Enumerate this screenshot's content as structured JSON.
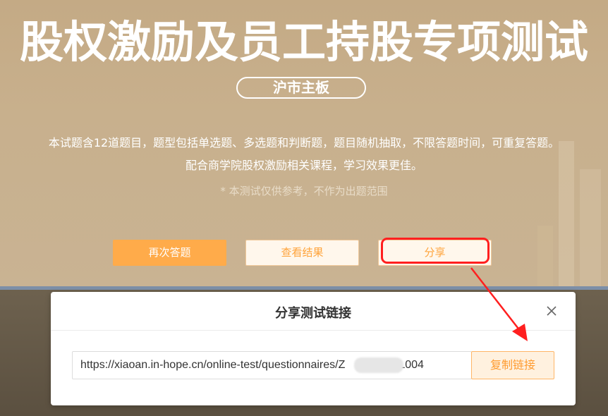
{
  "hero": {
    "title": "股权激励及员工持股专项测试",
    "market_label": "沪市主板",
    "description_line1": "本试题含12道题目，题型包括单选题、多选题和判断题，题目随机抽取，不限答题时间，可重复答题。",
    "description_line2": "配合商学院股权激励相关课程，学习效果更佳。",
    "note": "* 本测试仅供参考，不作为出题范围"
  },
  "actions": {
    "retry_label": "再次答题",
    "view_result_label": "查看结果",
    "share_label": "分享"
  },
  "share_modal": {
    "title": "分享测试链接",
    "close_icon": "close-icon",
    "link_prefix": "https://xiaoan.in-hope.cn/online-test/questionnaires/Z",
    "link_suffix": "JL004",
    "copy_label": "复制链接"
  },
  "colors": {
    "accent": "#ffab4a",
    "highlight": "#ff1f1f",
    "hero_bg": "#c8b08d"
  }
}
